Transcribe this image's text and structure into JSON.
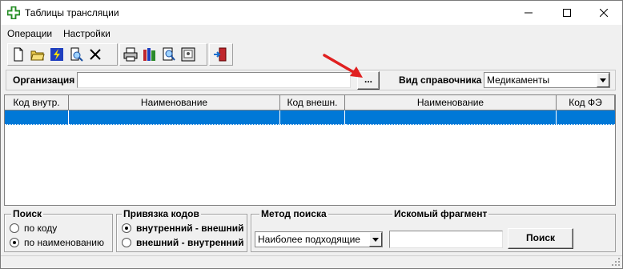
{
  "window": {
    "title": "Таблицы трансляции",
    "minimize": "—",
    "maximize": "☐",
    "close": "✕"
  },
  "menu": {
    "items": [
      "Операции",
      "Настройки"
    ]
  },
  "toolbar": {
    "buttons": [
      "new-icon",
      "open-folder-icon",
      "lightning-icon",
      "search-doc-icon",
      "delete-icon",
      "print-icon",
      "books-icon",
      "find-icon",
      "view-icon",
      "exit-icon"
    ]
  },
  "organization": {
    "label": "Организация",
    "value": "",
    "browse_label": "..."
  },
  "directory_type": {
    "label": "Вид справочника",
    "selected": "Медикаменты"
  },
  "grid": {
    "columns": [
      "Код внутр.",
      "Наименование",
      "Код внешн.",
      "Наименование",
      "Код ФЭ"
    ],
    "rows": [
      [
        "",
        "",
        "",
        "",
        ""
      ]
    ]
  },
  "search_by": {
    "legend": "Поиск",
    "options": [
      "по коду",
      "по наименованию"
    ],
    "selected_index": 1
  },
  "code_binding": {
    "legend": "Привязка кодов",
    "options": [
      "внутренний - внешний",
      "внешний - внутренний"
    ],
    "selected_index": 0
  },
  "search_method": {
    "legend": "Метод поиска",
    "selected": "Наиболее подходящие"
  },
  "fragment": {
    "legend": "Искомый  фрагмент",
    "value": ""
  },
  "search_button": "Поиск",
  "colors": {
    "selection": "#0078d7",
    "arrow": "#e02020",
    "app_icon": "#2ca02c"
  }
}
